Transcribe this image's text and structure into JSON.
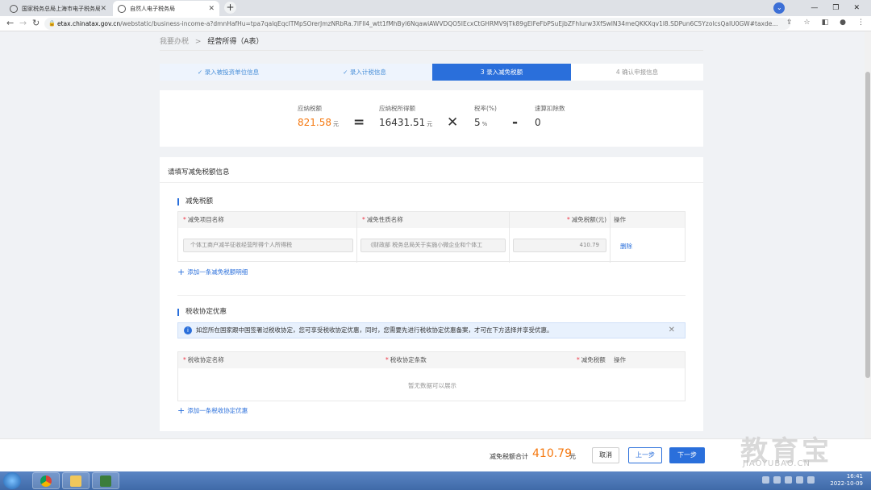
{
  "browser": {
    "tabs": [
      {
        "label": "国家税务总局上海市电子税务局",
        "close": "✕"
      },
      {
        "label": "自然人电子税务局",
        "close": "✕"
      }
    ],
    "new_tab": "+",
    "url_host": "etax.chinatax.gov.cn",
    "url_path": "/webstatic/business-income-a?dmnHafHu=tpa7qalqEqcITMpSOrerJmzNRbRa.7lFll4_wtt1fMhByl6NqawiAWVDQO5IEcxCtGHRMV9jTk89gElFeFbPSuEjbZFhIurw3XfSwIN34meQKKXqv1l8.SDPun6C5YzolcsQaIU0GW#taxde...",
    "window_buttons": {
      "minimize": "—",
      "restore": "❐",
      "close": "✕"
    }
  },
  "breadcrumb": {
    "root": "我要办税",
    "separator": ">",
    "current": "经营所得（A表）"
  },
  "steps": [
    {
      "label": "✓ 录入被投资单位信息",
      "state": "done"
    },
    {
      "label": "✓ 录入计税信息",
      "state": "done"
    },
    {
      "label": "3  录入减免税额",
      "state": "active"
    },
    {
      "label": "4  确认申报信息",
      "state": "todo"
    }
  ],
  "formula": {
    "tax_payable_label": "应纳税额",
    "tax_payable_value": "821.58",
    "tax_payable_unit": "元",
    "eq": "=",
    "taxable_income_label": "应纳税所得额",
    "taxable_income_value": "16431.51",
    "taxable_income_unit": "元",
    "times": "✕",
    "rate_label": "税率(%)",
    "rate_value": "5",
    "rate_unit": "%",
    "minus": "-",
    "deduction_label": "速算扣除数",
    "deduction_value": "0"
  },
  "reduction": {
    "card_title": "请填写减免税额信息",
    "section_title": "减免税额",
    "columns": [
      "减免项目名称",
      "减免性质名称",
      "减免税额(元)",
      "操作"
    ],
    "row": {
      "item_name": "个体工商户减半征收经营所得个人所得税",
      "nature_name": "《财政部 税务总局关于实施小微企业和个体工",
      "amount": "410.79",
      "action": "删除"
    },
    "add_link": "添加一条减免税额明细"
  },
  "treaty": {
    "section_title": "税收协定优惠",
    "alert": "如您所在国家跟中国签署过税收协定，您可享受税收协定优惠，同时，您需要先进行税收协定优惠备案，才可在下方选择并享受优惠。",
    "alert_close": "✕",
    "columns": [
      "税收协定名称",
      "税收协定条款",
      "减免税额",
      "操作"
    ],
    "empty": "暂无数据可以展示",
    "add_link": "添加一条税收协定优惠"
  },
  "footer": {
    "total_label": "减免税额合计",
    "total_value": "410.79",
    "total_unit": "元",
    "cancel": "取消",
    "prev": "上一步",
    "next": "下一步"
  },
  "watermark": {
    "main": "教育宝",
    "sub": "JIAOYUBAO.CN"
  },
  "taskbar": {
    "time": "16:41",
    "date": "2022-10-09"
  },
  "colors": {
    "primary": "#2a6fdb",
    "accent": "#f5780f"
  }
}
